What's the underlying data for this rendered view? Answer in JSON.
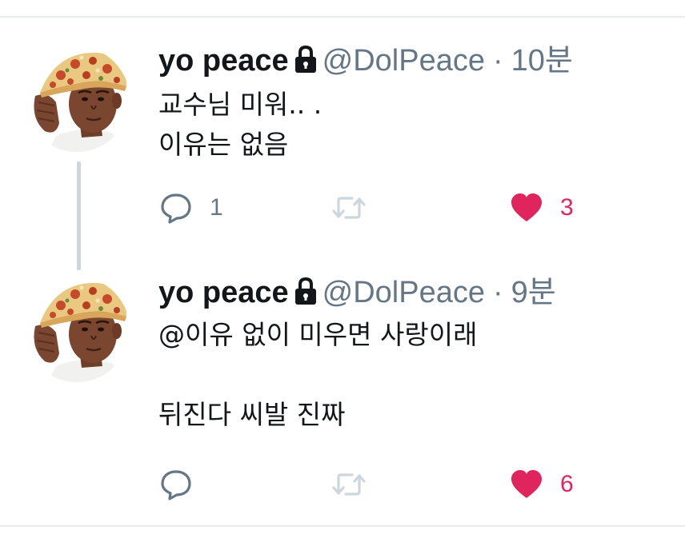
{
  "tweets": [
    {
      "name": "yo peace",
      "handle": "@DolPeace",
      "separator": "·",
      "time": "10분",
      "text": "교수님 미워.. .\n이유는 없음",
      "reply_count": "1",
      "retweet_count": "",
      "like_count": "3",
      "liked": true
    },
    {
      "name": "yo peace",
      "handle": "@DolPeace",
      "separator": "·",
      "time": "9분",
      "text": "@이유 없이 미우면 사랑이래\n\n뒤진다 씨발 진짜",
      "reply_count": "",
      "retweet_count": "",
      "like_count": "6",
      "liked": true
    }
  ],
  "icons": {
    "avatar": "avatar-pizza-cap",
    "lock": "lock-icon",
    "reply": "reply-icon",
    "retweet": "retweet-icon",
    "like": "heart-icon"
  },
  "colors": {
    "text": "#14171a",
    "secondary": "#657786",
    "retweet_icon": "#ccd6dd",
    "like": "#e0245e",
    "divider": "#e6ecf0"
  }
}
